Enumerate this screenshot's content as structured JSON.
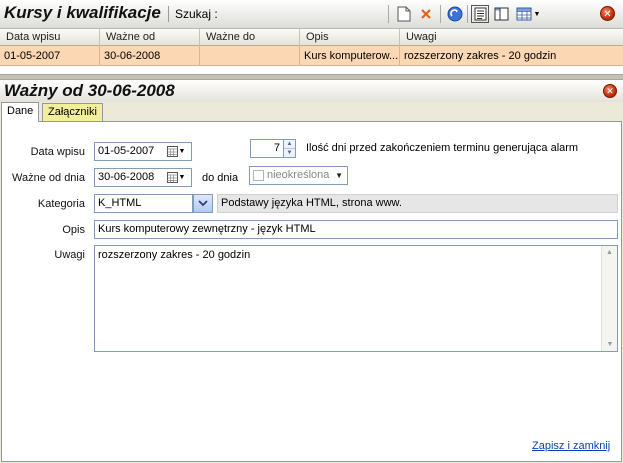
{
  "header": {
    "title": "Kursy i kwalifikacje",
    "search_label": "Szukaj :"
  },
  "grid": {
    "columns": [
      "Data wpisu",
      "Ważne od",
      "Ważne do",
      "Opis",
      "Uwagi"
    ],
    "rows": [
      {
        "data_wpisu": "01-05-2007",
        "wazne_od": "30-06-2008",
        "wazne_do": "",
        "opis": "Kurs komputerow...",
        "uwagi": "rozszerzony zakres - 20 godzin"
      }
    ]
  },
  "detail": {
    "title": "Ważny od 30-06-2008",
    "tabs": [
      "Dane",
      "Załączniki"
    ],
    "active_tab": "Dane"
  },
  "form": {
    "data_wpisu_label": "Data wpisu",
    "data_wpisu_value": "01-05-2007",
    "alarm_days_value": "7",
    "alarm_label": "Ilość dni przed zakończeniem terminu generująca alarm",
    "wazne_od_label": "Ważne od dnia",
    "wazne_od_value": "30-06-2008",
    "do_dnia_label": "do dnia",
    "nieokreslona_label": "nieokreślona",
    "kategoria_label": "Kategoria",
    "kategoria_value": "K_HTML",
    "kategoria_desc": "Podstawy języka HTML, strona www.",
    "opis_label": "Opis",
    "opis_value": "Kurs komputerowy zewnętrzny - język HTML",
    "uwagi_label": "Uwagi",
    "uwagi_value": "rozszerzony zakres - 20 godzin",
    "save_close_label": "Zapisz i zamknij"
  },
  "colors": {
    "selected_row": "#fbd7b3",
    "inactive_tab": "#f2ee9a",
    "link": "#0b3fbf",
    "close_button": "#c2300a"
  },
  "icons": [
    "new-document-icon",
    "delete-icon",
    "refresh-icon",
    "report-icon",
    "columns-icon",
    "grid-view-icon",
    "close-icon",
    "calendar-icon",
    "chevron-down-icon"
  ]
}
